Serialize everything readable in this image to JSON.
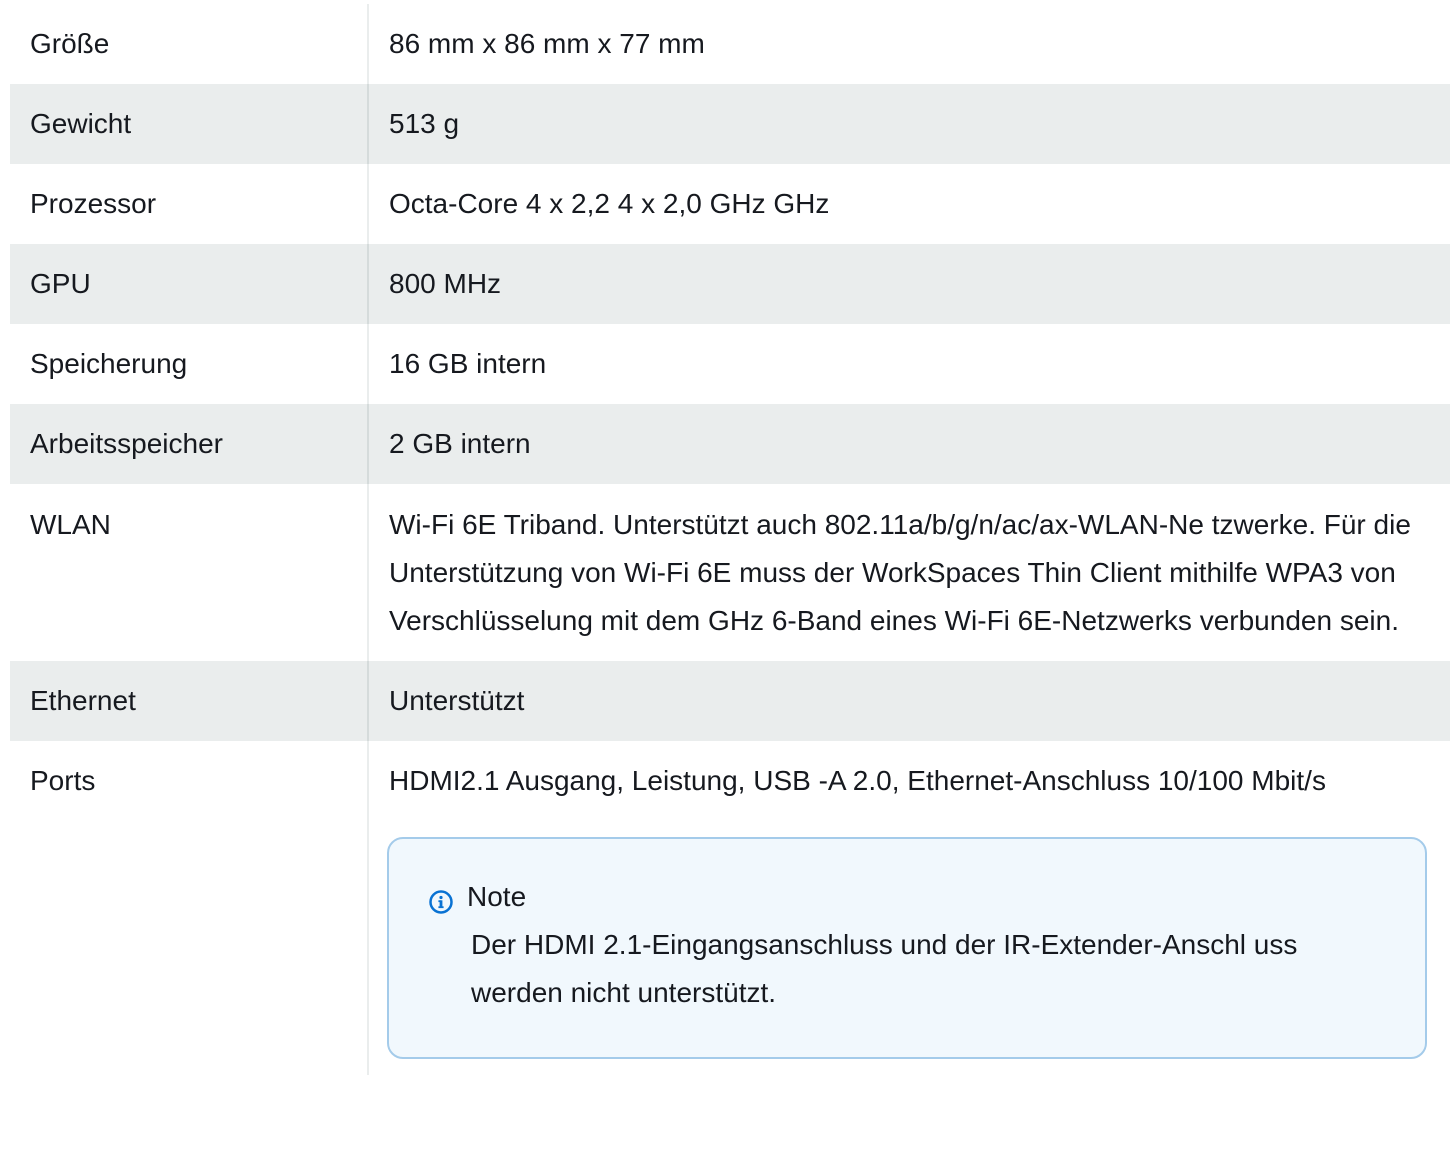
{
  "rows": [
    {
      "label": "Größe",
      "value": "86 mm x 86 mm x 77 mm"
    },
    {
      "label": "Gewicht",
      "value": "513 g"
    },
    {
      "label": "Prozessor",
      "value": "Octa-Core 4 x 2,2 4 x 2,0 GHz GHz"
    },
    {
      "label": "GPU",
      "value": "800 MHz"
    },
    {
      "label": "Speicherung",
      "value": "16 GB intern"
    },
    {
      "label": "Arbeitsspeicher",
      "value": "2 GB intern"
    },
    {
      "label": "WLAN",
      "value": "Wi-Fi 6E Triband. Unterstützt auch 802.11a/b/g/n/ac/ax-WLAN-Ne tzwerke. Für die Unterstützung von Wi-Fi 6E muss der WorkSpaces Thin Client mithilfe WPA3 von Verschlüsselung mit dem GHz 6-Band eines Wi-Fi 6E-Netzwerks verbunden sein."
    },
    {
      "label": "Ethernet",
      "value": "Unterstützt"
    },
    {
      "label": "Ports",
      "value": "HDMI2.1 Ausgang, Leistung, USB -A 2.0, Ethernet-Anschluss 10/100 Mbit/s"
    }
  ],
  "note": {
    "icon": "info-icon",
    "title": "Note",
    "body": "Der HDMI 2.1-Eingangsanschluss und der IR-Extender-Anschl uss werden nicht unterstützt."
  },
  "colors": {
    "row_shade": "#eaeded",
    "note_border": "#a4cbea",
    "note_bg": "#f1f8fd",
    "info_icon": "#0972d3"
  }
}
